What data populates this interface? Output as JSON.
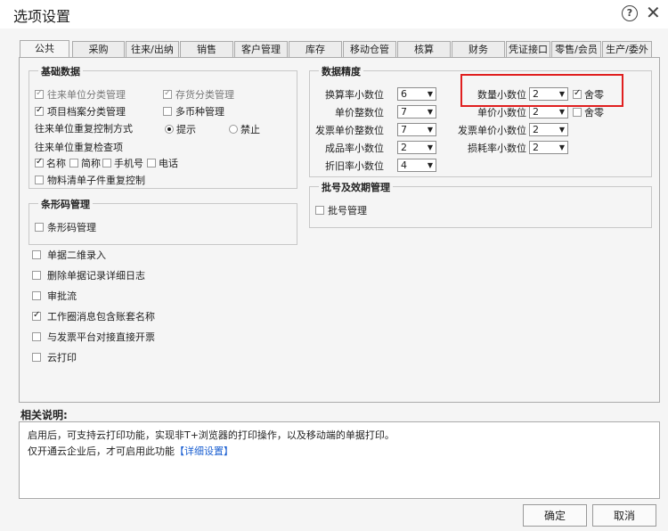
{
  "window": {
    "title": "选项设置",
    "help_glyph": "?",
    "close_glyph": "✕"
  },
  "tabs": [
    "公共",
    "采购",
    "往来/出纳",
    "销售",
    "客户管理",
    "库存",
    "移动仓管",
    "核算",
    "财务",
    "凭证接口",
    "零售/会员",
    "生产/委外"
  ],
  "basic": {
    "title": "基础数据",
    "items": {
      "partner_class": "往来单位分类管理",
      "inventory_class": "存货分类管理",
      "project_class": "项目档案分类管理",
      "multi_currency": "多币种管理",
      "dup_method_label": "往来单位重复控制方式",
      "radio_prompt": "提示",
      "radio_forbid": "禁止",
      "dup_check_label": "往来单位重复检查项",
      "name": "名称",
      "abbr": "简称",
      "mobile": "手机号",
      "phone": "电话",
      "logistics": "物料清单子件重复控制"
    }
  },
  "barcode": {
    "title": "条形码管理",
    "item": "条形码管理"
  },
  "misc": [
    "单据二维录入",
    "删除单据记录详细日志",
    "审批流",
    "工作圈消息包含账套名称",
    "与发票平台对接直接开票",
    "云打印"
  ],
  "precision": {
    "title": "数据精度",
    "left": [
      {
        "label": "换算率小数位",
        "value": "6"
      },
      {
        "label": "单价整数位",
        "value": "7"
      },
      {
        "label": "发票单价整数位",
        "value": "7"
      },
      {
        "label": "成品率小数位",
        "value": "2"
      },
      {
        "label": "折旧率小数位",
        "value": "4"
      }
    ],
    "right": [
      {
        "label": "数量小数位",
        "value": "2"
      },
      {
        "label": "单价小数位",
        "value": "2"
      },
      {
        "label": "发票单价小数位",
        "value": "2"
      },
      {
        "label": "损耗率小数位",
        "value": "2"
      }
    ],
    "round_label": "舍零",
    "round_label2": "舍零"
  },
  "batch": {
    "title": "批号及效期管理",
    "item": "批号管理"
  },
  "description": {
    "title": "相关说明:",
    "line1": "启用后，可支持云打印功能，实现非T+浏览器的打印操作，以及移动端的单据打印。",
    "line2": "仅开通云企业后，才可启用此功能",
    "link": "【详细设置】"
  },
  "buttons": {
    "ok": "确定",
    "cancel": "取消"
  },
  "colors": {
    "highlight": "#e01f1f",
    "link": "#1a5fd1"
  }
}
